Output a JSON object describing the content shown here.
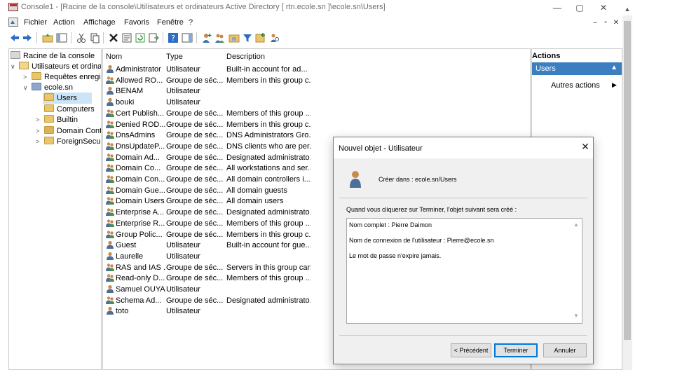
{
  "window": {
    "title": "Console1 - [Racine de la console\\Utilisateurs et ordinateurs Active Directory [ rtn.ecole.sn ]\\ecole.sn\\Users]",
    "minimize": "—",
    "maximize": "▢",
    "close": "✕"
  },
  "menu": {
    "items": [
      "Fichier",
      "Action",
      "Affichage",
      "Favoris",
      "Fenêtre",
      "?"
    ],
    "mdi_min": "–",
    "mdi_restore": "▫",
    "mdi_close": "✕"
  },
  "tree": {
    "items": [
      {
        "label": "Racine de la console",
        "twisty": ""
      },
      {
        "label": "Utilisateurs et ordinateurs",
        "twisty": "∨"
      },
      {
        "label": "Requêtes enregistrées",
        "twisty": ">"
      },
      {
        "label": "ecole.sn",
        "twisty": "∨"
      },
      {
        "label": "Users",
        "twisty": ""
      },
      {
        "label": "Computers",
        "twisty": ""
      },
      {
        "label": "Builtin",
        "twisty": ">"
      },
      {
        "label": "Domain Controllers",
        "twisty": ">"
      },
      {
        "label": "ForeignSecurityPrincipals",
        "twisty": ">"
      }
    ]
  },
  "list": {
    "headers": {
      "name": "Nom",
      "type": "Type",
      "description": "Description"
    },
    "rows": [
      {
        "name": "Administrator",
        "type": "Utilisateur",
        "description": "Built-in account for ad...",
        "icon": "user"
      },
      {
        "name": "Allowed RO...",
        "type": "Groupe de séc...",
        "description": "Members in this group c...",
        "icon": "group"
      },
      {
        "name": "BENAM",
        "type": "Utilisateur",
        "description": "",
        "icon": "user"
      },
      {
        "name": "bouki",
        "type": "Utilisateur",
        "description": "",
        "icon": "user"
      },
      {
        "name": "Cert Publish...",
        "type": "Groupe de séc...",
        "description": "Members of this group ...",
        "icon": "group"
      },
      {
        "name": "Denied ROD...",
        "type": "Groupe de séc...",
        "description": "Members in this group c...",
        "icon": "group"
      },
      {
        "name": "DnsAdmins",
        "type": "Groupe de séc...",
        "description": "DNS Administrators Gro...",
        "icon": "group"
      },
      {
        "name": "DnsUpdateP...",
        "type": "Groupe de séc...",
        "description": "DNS clients who are per...",
        "icon": "group"
      },
      {
        "name": "Domain Ad...",
        "type": "Groupe de séc...",
        "description": "Designated administrato...",
        "icon": "group"
      },
      {
        "name": "Domain Co...",
        "type": "Groupe de séc...",
        "description": "All workstations and ser...",
        "icon": "group"
      },
      {
        "name": "Domain Con...",
        "type": "Groupe de séc...",
        "description": "All domain controllers i...",
        "icon": "group"
      },
      {
        "name": "Domain Gue...",
        "type": "Groupe de séc...",
        "description": "All domain guests",
        "icon": "group"
      },
      {
        "name": "Domain Users",
        "type": "Groupe de séc...",
        "description": "All domain users",
        "icon": "group"
      },
      {
        "name": "Enterprise A...",
        "type": "Groupe de séc...",
        "description": "Designated administrato...",
        "icon": "group"
      },
      {
        "name": "Enterprise R...",
        "type": "Groupe de séc...",
        "description": "Members of this group ...",
        "icon": "group"
      },
      {
        "name": "Group Polic...",
        "type": "Groupe de séc...",
        "description": "Members in this group c...",
        "icon": "group"
      },
      {
        "name": "Guest",
        "type": "Utilisateur",
        "description": "Built-in account for gue...",
        "icon": "user"
      },
      {
        "name": "Laurelle",
        "type": "Utilisateur",
        "description": "",
        "icon": "user"
      },
      {
        "name": "RAS and IAS ...",
        "type": "Groupe de séc...",
        "description": "Servers in this group can...",
        "icon": "group"
      },
      {
        "name": "Read-only D...",
        "type": "Groupe de séc...",
        "description": "Members of this group ...",
        "icon": "group"
      },
      {
        "name": "Samuel OUYA",
        "type": "Utilisateur",
        "description": "",
        "icon": "user"
      },
      {
        "name": "Schema Ad...",
        "type": "Groupe de séc...",
        "description": "Designated administrato...",
        "icon": "group"
      },
      {
        "name": "toto",
        "type": "Utilisateur",
        "description": "",
        "icon": "user"
      }
    ]
  },
  "actions": {
    "header": "Actions",
    "selected": "Users",
    "more": "Autres actions"
  },
  "dialog": {
    "title": "Nouvel objet - Utilisateur",
    "created_in": "Créer dans :   ecole.sn/Users",
    "intro": "Quand vous cliquerez sur Terminer, l'objet suivant sera créé :",
    "summary": [
      "Nom complet : Pierre Daimon",
      "Nom de connexion de l'utilisateur : Pierre@ecole.sn",
      "Le mot de passe n'expire jamais."
    ],
    "buttons": {
      "back": "< Précédent",
      "finish": "Terminer",
      "cancel": "Annuler"
    }
  },
  "colors": {
    "selection": "#cce4f7",
    "accent": "#3c7fc1",
    "folder": "#e9c56b"
  }
}
